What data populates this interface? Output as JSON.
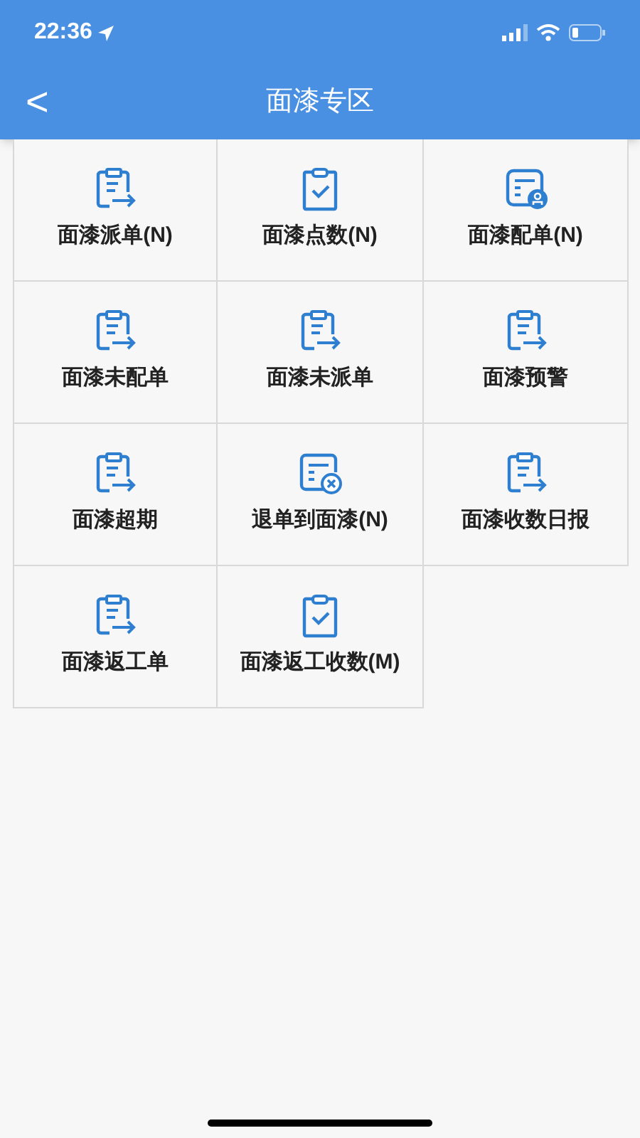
{
  "status_bar": {
    "time": "22:36"
  },
  "nav": {
    "back": "<",
    "title": "面漆专区"
  },
  "tiles": [
    {
      "label": "面漆派单(N)",
      "kind": "transfer"
    },
    {
      "label": "面漆点数(N)",
      "kind": "check"
    },
    {
      "label": "面漆配单(N)",
      "kind": "assign"
    },
    {
      "label": "面漆未配单",
      "kind": "transfer"
    },
    {
      "label": "面漆未派单",
      "kind": "transfer"
    },
    {
      "label": "面漆预警",
      "kind": "transfer"
    },
    {
      "label": "面漆超期",
      "kind": "transfer"
    },
    {
      "label": "退单到面漆(N)",
      "kind": "cancel"
    },
    {
      "label": "面漆收数日报",
      "kind": "transfer"
    },
    {
      "label": "面漆返工单",
      "kind": "transfer"
    },
    {
      "label": "面漆返工收数(M)",
      "kind": "check"
    }
  ]
}
